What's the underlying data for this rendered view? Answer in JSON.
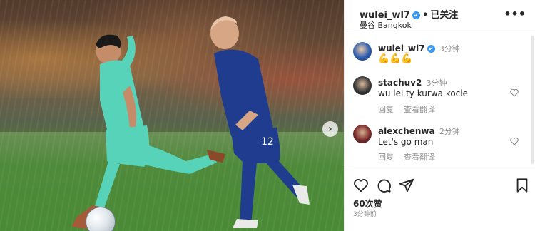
{
  "post": {
    "username": "wulei_wl7",
    "verified_mark": "✔",
    "separator": "•",
    "follow_state": "已关注",
    "location": "曼谷 Bangkok",
    "more_glyph": "•••"
  },
  "caption": {
    "username": "wulei_wl7",
    "time": "3分钟",
    "text": "💪💪💪"
  },
  "comments": [
    {
      "username": "stachuv2",
      "time": "3分钟",
      "text": "wu lei ty kurwa kocie",
      "reply_label": "回复",
      "translate_label": "查看翻译"
    },
    {
      "username": "alexchenwa",
      "time": "2分钟",
      "text": "Let's go man",
      "reply_label": "回复",
      "translate_label": "查看翻译"
    }
  ],
  "footer": {
    "likes": "60次赞",
    "posted_time": "3分钟前"
  },
  "media": {
    "next_glyph": "›"
  },
  "colors": {
    "verified": "#3897f0",
    "muted": "#8e8e8e",
    "text": "#262626",
    "thailand_kit": "#1f3c8f",
    "china_kit": "#56d3b9"
  },
  "icons": [
    "heart-icon",
    "comment-icon",
    "share-icon",
    "bookmark-icon",
    "more-icon",
    "next-arrow-icon",
    "verified-badge-icon"
  ]
}
